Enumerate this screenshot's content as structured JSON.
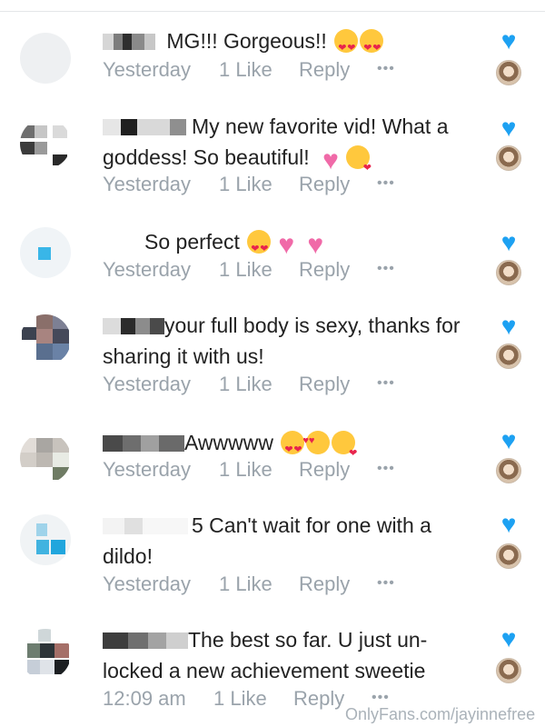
{
  "colors": {
    "accent": "#1da1f2",
    "meta_text": "#9aa3ab",
    "text": "#222222"
  },
  "icons": {
    "like": "heart-icon",
    "creator": "avatar",
    "more": "more-dots-icon"
  },
  "comments": [
    {
      "text": "MG!!! Gorgeous!!",
      "emojis": [
        "heart-eyes",
        "heart-eyes"
      ],
      "timestamp": "Yesterday",
      "likes": "1 Like",
      "reply": "Reply",
      "more": "•••"
    },
    {
      "text": "My new favorite vid! What a goddess! So beautiful!",
      "emojis": [
        "pink-heart",
        "kiss"
      ],
      "timestamp": "Yesterday",
      "likes": "1 Like",
      "reply": "Reply",
      "more": "•••"
    },
    {
      "text": "So perfect",
      "emojis": [
        "heart-eyes",
        "pink-heart",
        "pink-heart"
      ],
      "timestamp": "Yesterday",
      "likes": "1 Like",
      "reply": "Reply",
      "more": "•••"
    },
    {
      "text": "your full body is sexy, thanks for sharing it with us!",
      "emojis": [],
      "timestamp": "Yesterday",
      "likes": "1 Like",
      "reply": "Reply",
      "more": "•••"
    },
    {
      "text": "Awwwww",
      "emojis": [
        "heart-eyes",
        "smile-hearts",
        "kiss"
      ],
      "timestamp": "Yesterday",
      "likes": "1 Like",
      "reply": "Reply",
      "more": "•••"
    },
    {
      "text": "5 Can't wait for one with a dildo!",
      "emojis": [],
      "timestamp": "Yesterday",
      "likes": "1 Like",
      "reply": "Reply",
      "more": "•••"
    },
    {
      "text": "The best so far. U just un- locked a new achievement sweetie",
      "emojis": [],
      "timestamp": "12:09 am",
      "likes": "1 Like",
      "reply": "Reply",
      "more": "•••"
    }
  ],
  "watermark": "OnlyFans.com/jayinnefree"
}
